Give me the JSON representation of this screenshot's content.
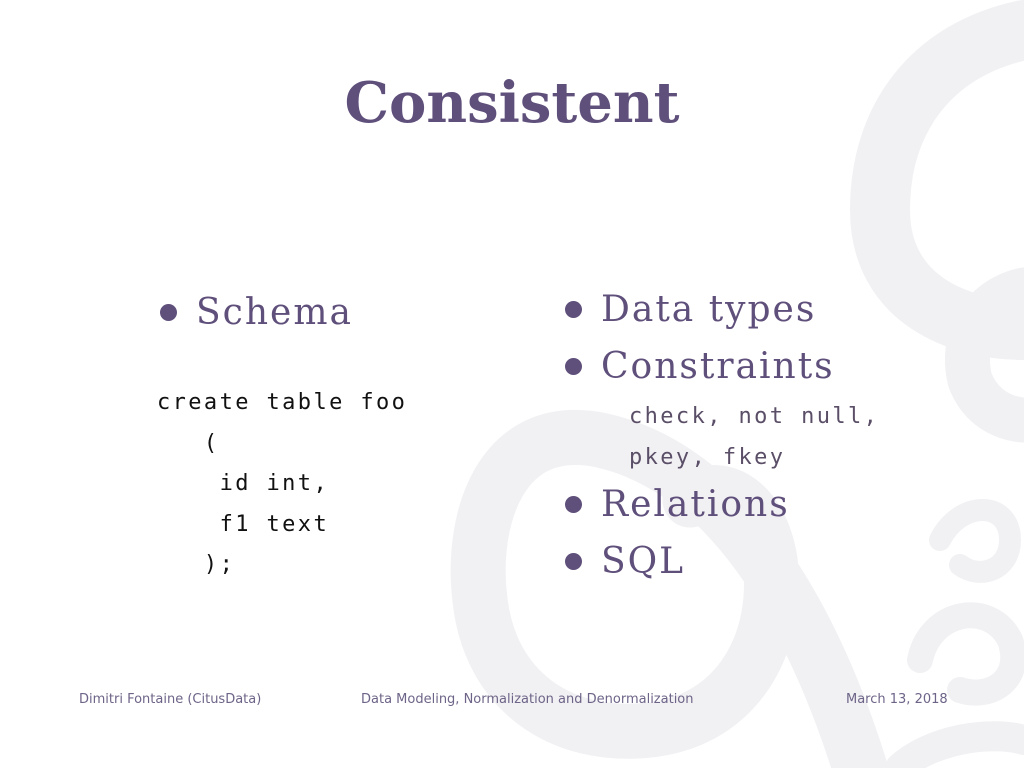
{
  "slide": {
    "title": "Consistent"
  },
  "left_column": {
    "bullet": "Schema",
    "code_lines": [
      "create table foo",
      "   (",
      "    id int,",
      "    f1 text",
      "   );"
    ]
  },
  "right_column": {
    "bullets": [
      "Data types",
      "Constraints",
      "Relations",
      "SQL"
    ],
    "constraints_detail": [
      "check, not null,",
      "pkey, fkey"
    ]
  },
  "footer": {
    "author": "Dimitri Fontaine (CitusData)",
    "talk_title": "Data Modeling, Normalization and Denormalization",
    "date": "March 13, 2018"
  },
  "colors": {
    "title": "#5f4f7b",
    "bullet_text": "#5f4f7b",
    "code_text": "#111111",
    "footer_text": "#6e6488",
    "ornament": "#f1f0f3"
  },
  "icons": {
    "bullet": "filled-circle",
    "background": "decorative-swirl-ornament"
  }
}
